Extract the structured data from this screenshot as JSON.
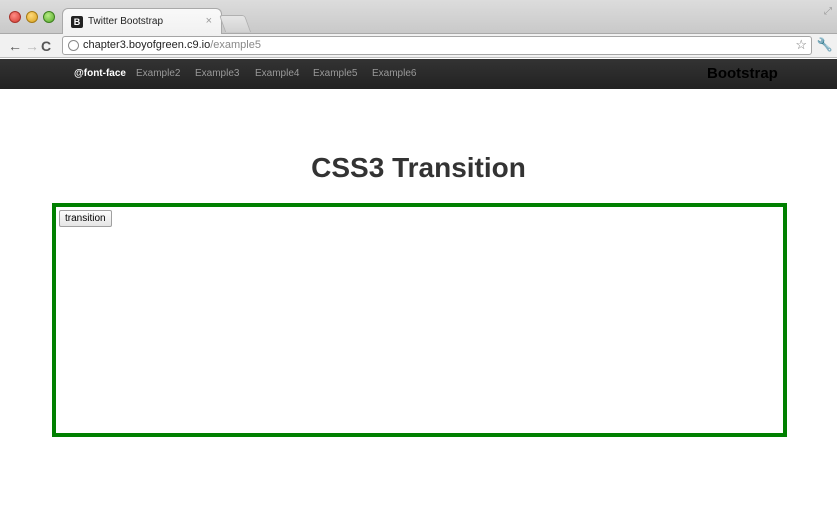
{
  "browser": {
    "tab_title": "Twitter Bootstrap",
    "tab_favicon": "B",
    "tab_close": "×",
    "url_host": "chapter3.boyofgreen.c9.io",
    "url_path": "/example5",
    "icons": [
      "back-arrow-icon",
      "forward-arrow-icon",
      "reload-icon",
      "page-icon",
      "star-icon",
      "wrench-icon"
    ]
  },
  "navbar": {
    "links": [
      "@font-face",
      "Example2",
      "Example3",
      "Example4",
      "Example5",
      "Example6"
    ],
    "active_index": 0,
    "brand": "Bootstrap"
  },
  "main": {
    "title": "CSS3 Transition",
    "button_label": "transition",
    "box_border_color": "#008000"
  }
}
